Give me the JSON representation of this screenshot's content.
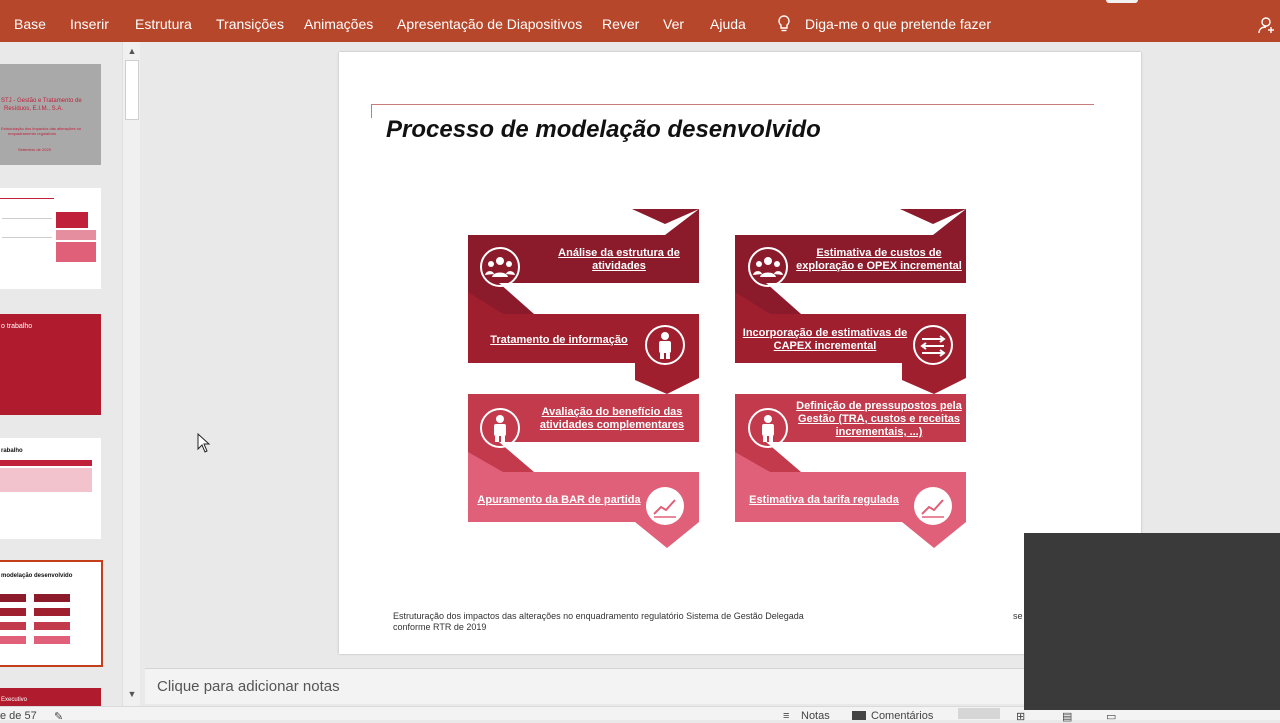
{
  "ribbon": {
    "tabs": [
      "Base",
      "Inserir",
      "Estrutura",
      "Transições",
      "Animações",
      "Apresentação de Diapositivos",
      "Rever",
      "Ver",
      "Ajuda"
    ],
    "tell_me": "Diga-me o que pretende fazer",
    "colors": {
      "bar": "#b7472a"
    }
  },
  "thumbnails": {
    "t1_line1": "STJ - Gestão e Tratamento de",
    "t1_line2": "Resíduos, E.I.M., S.A.",
    "t1_line3": "Estruturação dos impactos das alterações no",
    "t1_line4": "enquadramento regulatório",
    "t1_line5": "Setembro de 2020",
    "t3_title": "o trabalho",
    "t4_title": "rabalho",
    "t5_title": "modelação desenvolvido",
    "t6_title": "Executivo"
  },
  "slide": {
    "title": "Processo de modelação desenvolvido",
    "footer": "Estruturação dos impactos das alterações no enquadramento regulatório Sistema de Gestão Delegada conforme RTR de 2019",
    "footer_right": "se"
  },
  "flow": {
    "left": [
      {
        "label": "Análise da estrutura  de atividades",
        "icon": "people-icon"
      },
      {
        "label": "Tratamento de informação",
        "icon": "person-icon"
      },
      {
        "label": "Avaliação do benefício das atividades complementares",
        "icon": "person-icon"
      },
      {
        "label": "Apuramento da BAR de partida",
        "icon": "chart-icon"
      }
    ],
    "right": [
      {
        "label": "Estimativa de custos de exploração e OPEX incremental",
        "icon": "people-icon"
      },
      {
        "label": "Incorporação de estimativas de CAPEX incremental",
        "icon": "arrows-icon"
      },
      {
        "label": "Definição de pressupostos pela Gestão (TRA, custos e receitas incrementais, ...)",
        "icon": "person-icon"
      },
      {
        "label": "Estimativa da tarifa regulada",
        "icon": "chart-icon"
      }
    ],
    "colors": [
      "#8b1a2b",
      "#a01f2e",
      "#c23a4c",
      "#e06079"
    ]
  },
  "notes": {
    "placeholder": "Clique para adicionar notas"
  },
  "status": {
    "slide_count": "e de 57",
    "notes": "Notas",
    "comments": "Comentários"
  }
}
